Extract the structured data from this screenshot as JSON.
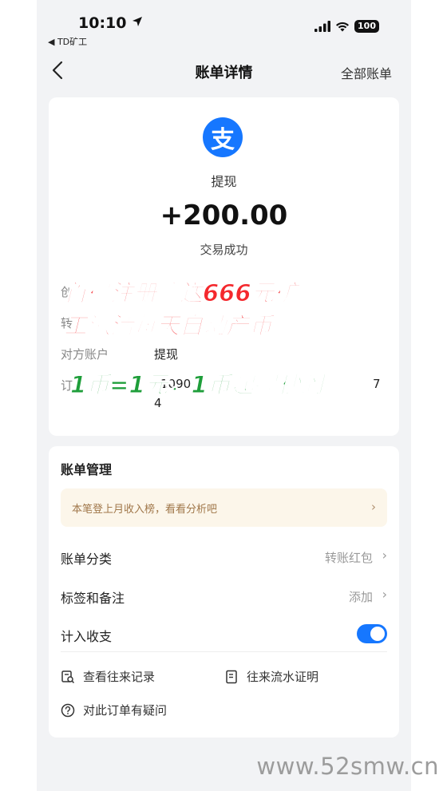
{
  "status_bar": {
    "time": "10:10",
    "back_app": "◀ TD矿工",
    "battery": "100"
  },
  "nav": {
    "title": "账单详情",
    "right_link": "全部账单"
  },
  "transaction": {
    "type": "提现",
    "amount": "+200.00",
    "status": "交易成功",
    "logo_glyph": "支",
    "details": [
      {
        "label": "创",
        "value": ""
      },
      {
        "label": "转",
        "value": ""
      },
      {
        "label": "对方账户",
        "value": "提现"
      },
      {
        "label": "订",
        "value": "1090"
      }
    ],
    "order_id_tail_1": "7",
    "order_id_tail_2": "4"
  },
  "promo_overlay": {
    "line1": "首码注册赠送666元矿",
    "line2": "工激活每天自动产币",
    "line3": "1币=1元，1币起提秒到"
  },
  "bill_management": {
    "section_title": "账单管理",
    "tip": "本笔登上月收入榜，看看分析吧",
    "rows": [
      {
        "label": "账单分类",
        "value": "转账红包"
      },
      {
        "label": "标签和备注",
        "value": "添加"
      },
      {
        "label": "计入收支",
        "value": ""
      }
    ],
    "toggle_on": true,
    "links": [
      {
        "label": "查看往来记录",
        "icon": "search-record-icon"
      },
      {
        "label": "往来流水证明",
        "icon": "document-icon"
      },
      {
        "label": "对此订单有疑问",
        "icon": "question-icon"
      }
    ]
  },
  "watermark": "www.52smw.cn",
  "colors": {
    "accent": "#1677ff",
    "promo_red": "#f4282d",
    "promo_green": "#1e9e3a",
    "tip_bg": "#fcf6ea",
    "tip_text": "#a0774a"
  }
}
